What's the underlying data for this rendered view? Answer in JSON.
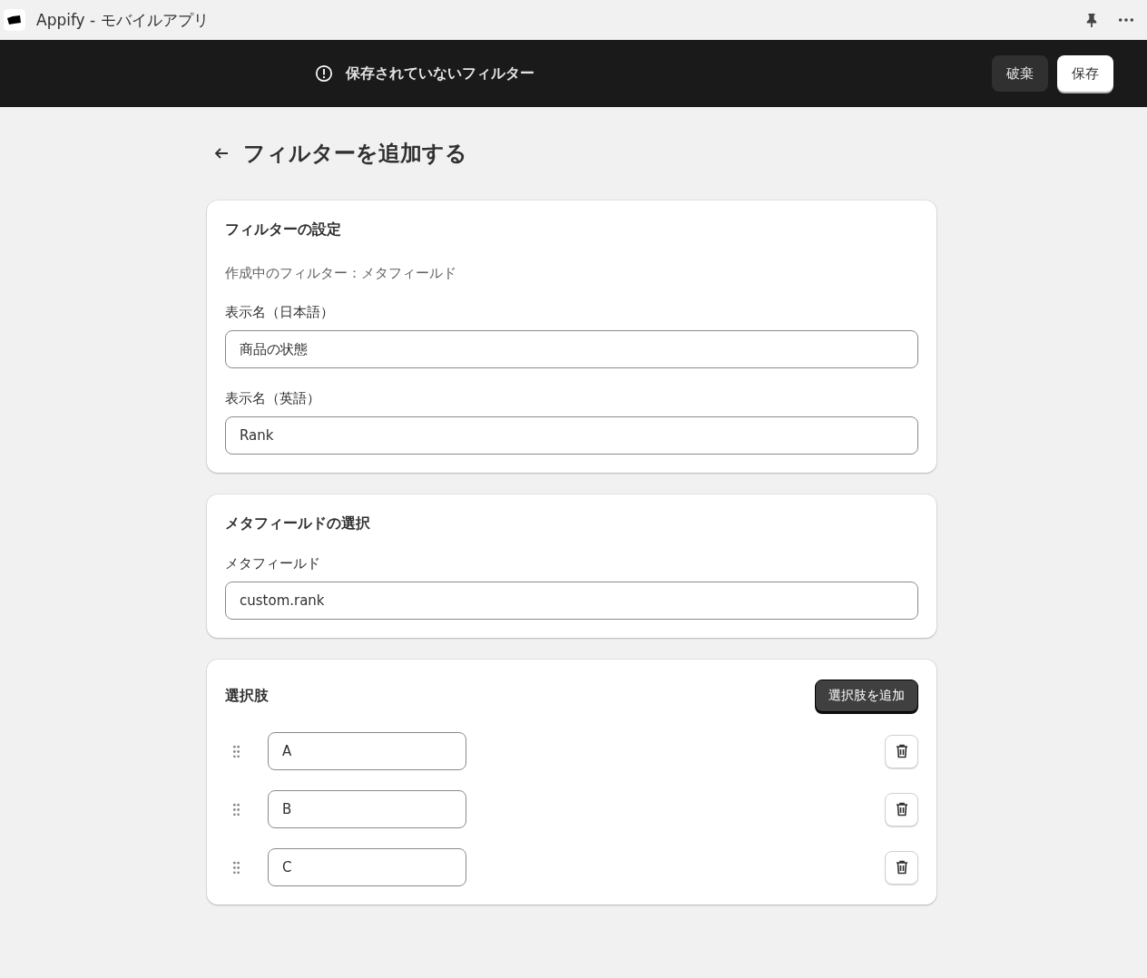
{
  "app_bar": {
    "title": "Appify - モバイルアプリ"
  },
  "save_bar": {
    "message": "保存されていないフィルター",
    "buttons": [
      {
        "kind": "secondary",
        "label": "破棄"
      },
      {
        "kind": "primary",
        "label": "保存"
      }
    ]
  },
  "page": {
    "title": "フィルターを追加する"
  },
  "cards": [
    {
      "kind": "form",
      "title": "フィルターの設定",
      "note": "作成中のフィルター：メタフィールド",
      "fields": [
        {
          "label": "表示名（日本語）",
          "value": "商品の状態"
        },
        {
          "label": "表示名（英語）",
          "value": "Rank"
        }
      ]
    },
    {
      "kind": "form",
      "title": "メタフィールドの選択",
      "fields": [
        {
          "label": "メタフィールド",
          "value": "custom.rank"
        }
      ]
    },
    {
      "kind": "options",
      "title": "選択肢",
      "button": "選択肢を追加",
      "options": [
        {
          "value": "A"
        },
        {
          "value": "B"
        },
        {
          "value": "C"
        }
      ]
    }
  ]
}
